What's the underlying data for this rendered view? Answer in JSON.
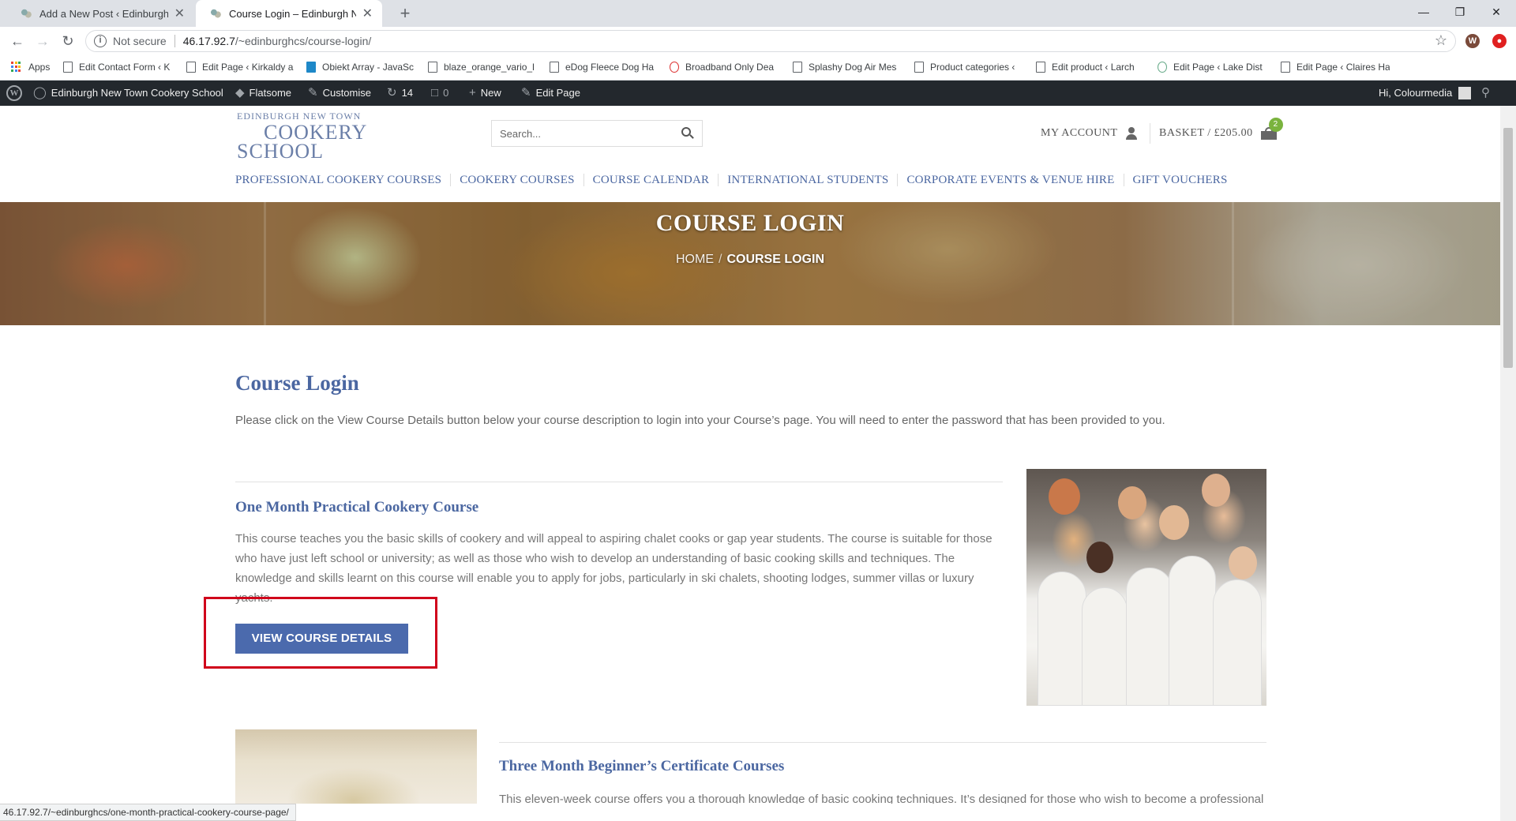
{
  "browser": {
    "tabs": [
      {
        "title": "Add a New Post ‹ Edinburgh New Town Cookery School",
        "active": false
      },
      {
        "title": "Course Login – Edinburgh New Town Cookery School",
        "active": true
      }
    ],
    "address": {
      "security": "Not secure",
      "host": "46.17.92.7",
      "path": "/~edinburghcs/course-login/"
    },
    "profile_initial": "W",
    "bookmarks": [
      "Apps",
      "Edit Contact Form ‹ K",
      "Edit Page ‹ Kirkaldy a",
      "Obiekt Array - JavaSc",
      "blaze_orange_vario_l",
      "eDog Fleece Dog Ha",
      "Broadband Only Dea",
      "Splashy Dog Air Mes",
      "Product categories ‹",
      "Edit product ‹ Larch",
      "Edit Page ‹ Lake Dist",
      "Edit Page ‹ Claires Ha"
    ]
  },
  "adminbar": {
    "site_name": "Edinburgh New Town Cookery School",
    "theme": "Flatsome",
    "customise": "Customise",
    "updates": "14",
    "comments": "0",
    "new": "New",
    "edit_page": "Edit Page",
    "greeting": "Hi, Colourmedia"
  },
  "header": {
    "logo": {
      "line1": "EDINBURGH NEW TOWN",
      "line2": "COOKERY",
      "line3": "SCHOOL"
    },
    "search_placeholder": "Search...",
    "my_account": "MY ACCOUNT",
    "basket": "BASKET / £205.00",
    "basket_count": "2",
    "nav": [
      "PROFESSIONAL COOKERY COURSES",
      "COOKERY COURSES",
      "COURSE CALENDAR",
      "INTERNATIONAL STUDENTS",
      "CORPORATE EVENTS & VENUE HIRE",
      "GIFT VOUCHERS"
    ]
  },
  "hero": {
    "title": "COURSE LOGIN",
    "breadcrumb_home": "HOME",
    "breadcrumb_divider": "/",
    "breadcrumb_current": "COURSE LOGIN"
  },
  "content": {
    "title": "Course Login",
    "intro": "Please click on the View Course Details button below your course description to login into your Course’s page. You will need to enter the password that has been provided to you.",
    "courses": [
      {
        "title": "One Month Practical Cookery Course",
        "description": "This course teaches you the basic skills of cookery and will appeal to aspiring chalet cooks or gap year students. The course is suitable for those who have just left school or university; as well as those who wish to develop an understanding of basic cooking skills and techniques. The knowledge and skills learnt on this course will enable you to apply for jobs, particularly in ski chalets, shooting lodges, summer villas or luxury yachts.",
        "button": "VIEW COURSE DETAILS"
      },
      {
        "title": "Three Month Beginner’s Certificate Courses",
        "description": "This eleven-week course offers you a thorough knowledge of basic cooking techniques. It’s designed for those who wish to become a professional cook and enter the food industry. It is also suitable for those wishing to learn the basics of classical cookery as a life skill."
      }
    ]
  },
  "status_url": "46.17.92.7/~edinburghcs/one-month-practical-cookery-course-page/",
  "colors": {
    "accent_blue": "#4b67a1",
    "button_blue": "#4b6aad",
    "admin_bar": "#23282d",
    "highlight_red": "#d0021b",
    "badge_green": "#7ab33e"
  }
}
